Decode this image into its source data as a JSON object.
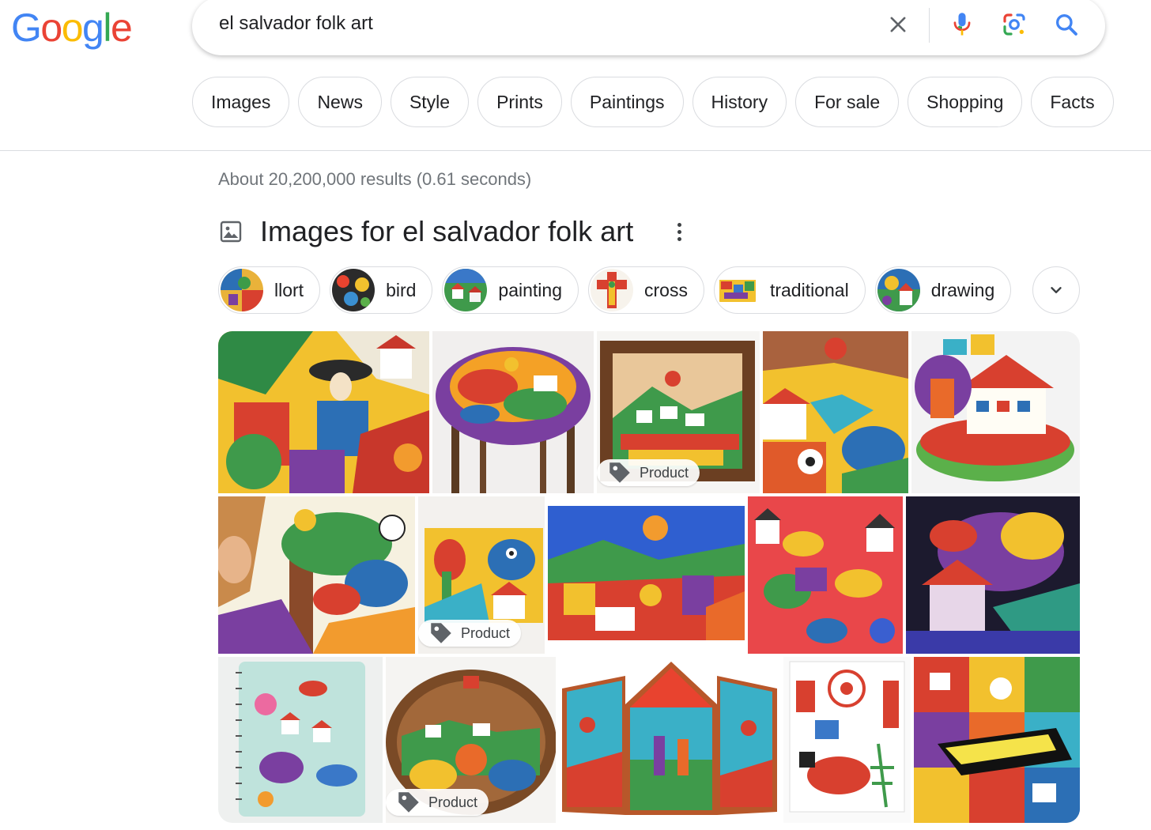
{
  "logo": {
    "text": "Google",
    "letters": [
      "G",
      "o",
      "o",
      "g",
      "l",
      "e"
    ],
    "colors": [
      "#4285F4",
      "#EA4335",
      "#FBBC05",
      "#4285F4",
      "#34A853",
      "#EA4335"
    ]
  },
  "search": {
    "query": "el salvador folk art"
  },
  "filters": [
    "Images",
    "News",
    "Style",
    "Prints",
    "Paintings",
    "History",
    "For sale",
    "Shopping",
    "Facts"
  ],
  "stats": "About 20,200,000 results (0.61 seconds)",
  "images_section": {
    "title": "Images for el salvador folk art",
    "chips": [
      "llort",
      "bird",
      "painting",
      "cross",
      "traditional",
      "drawing"
    ],
    "product_label": "Product"
  },
  "colors": {
    "accent_blue": "#1a73e8",
    "border": "#dadce0",
    "muted": "#70757a"
  }
}
